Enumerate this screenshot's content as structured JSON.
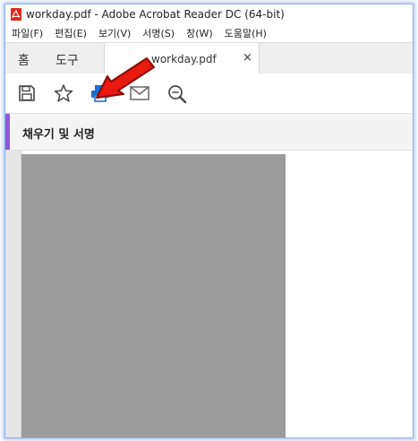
{
  "window": {
    "title": "workday.pdf - Adobe Acrobat Reader DC (64-bit)"
  },
  "menu": {
    "items": [
      "파일(F)",
      "편집(E)",
      "보기(V)",
      "서명(S)",
      "창(W)",
      "도움말(H)"
    ]
  },
  "tabs": {
    "home": "홈",
    "tools": "도구",
    "document": "workday.pdf",
    "close": "×"
  },
  "toolbar": {
    "icons": [
      "save-icon",
      "star-icon",
      "print-icon",
      "email-icon",
      "zoom-search-icon"
    ],
    "accent_color": "#1a6fd1"
  },
  "panel": {
    "title": "채우기 및 서명",
    "accent_color": "#8d5ad9"
  },
  "annotation": {
    "arrow_color": "#e8190f"
  }
}
